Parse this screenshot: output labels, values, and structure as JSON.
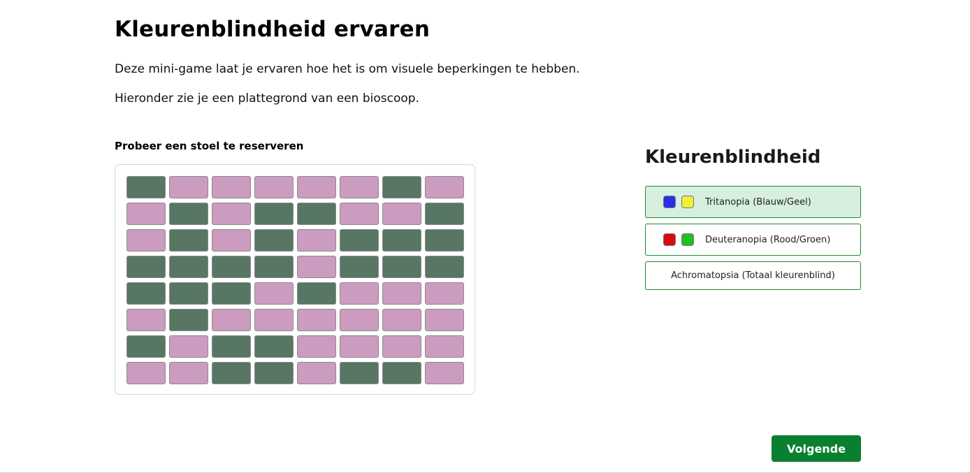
{
  "header": {
    "title": "Kleurenblindheid ervaren",
    "intro_1": "Deze mini-game laat je ervaren hoe het is om visuele beperkingen te hebben.",
    "intro_2": "Hieronder zie je een plattegrond van een bioscoop."
  },
  "seat_map": {
    "heading": "Probeer een stoel te reserveren",
    "colors": {
      "free": "#cc9cc0",
      "taken": "#587664"
    },
    "rows": [
      [
        "taken",
        "free",
        "free",
        "free",
        "free",
        "free",
        "taken",
        "free"
      ],
      [
        "free",
        "taken",
        "free",
        "taken",
        "taken",
        "free",
        "free",
        "taken"
      ],
      [
        "free",
        "taken",
        "free",
        "taken",
        "free",
        "taken",
        "taken",
        "taken"
      ],
      [
        "taken",
        "taken",
        "taken",
        "taken",
        "free",
        "taken",
        "taken",
        "taken"
      ],
      [
        "taken",
        "taken",
        "taken",
        "free",
        "taken",
        "free",
        "free",
        "free"
      ],
      [
        "free",
        "taken",
        "free",
        "free",
        "free",
        "free",
        "free",
        "free"
      ],
      [
        "taken",
        "free",
        "taken",
        "taken",
        "free",
        "free",
        "free",
        "free"
      ],
      [
        "free",
        "free",
        "taken",
        "taken",
        "free",
        "taken",
        "taken",
        "free"
      ]
    ]
  },
  "sidebar": {
    "title": "Kleurenblindheid",
    "modes": [
      {
        "label": "Tritanopia (Blauw/Geel)",
        "active": true,
        "swatches": [
          "#2a2ee6",
          "#eef03a"
        ]
      },
      {
        "label": "Deuteranopia (Rood/Groen)",
        "active": false,
        "swatches": [
          "#d70d0d",
          "#1fc01f"
        ]
      },
      {
        "label": "Achromatopsia (Totaal kleurenblind)",
        "active": false,
        "swatches": []
      }
    ]
  },
  "footer": {
    "next_label": "Volgende",
    "accent": "#08802f"
  }
}
